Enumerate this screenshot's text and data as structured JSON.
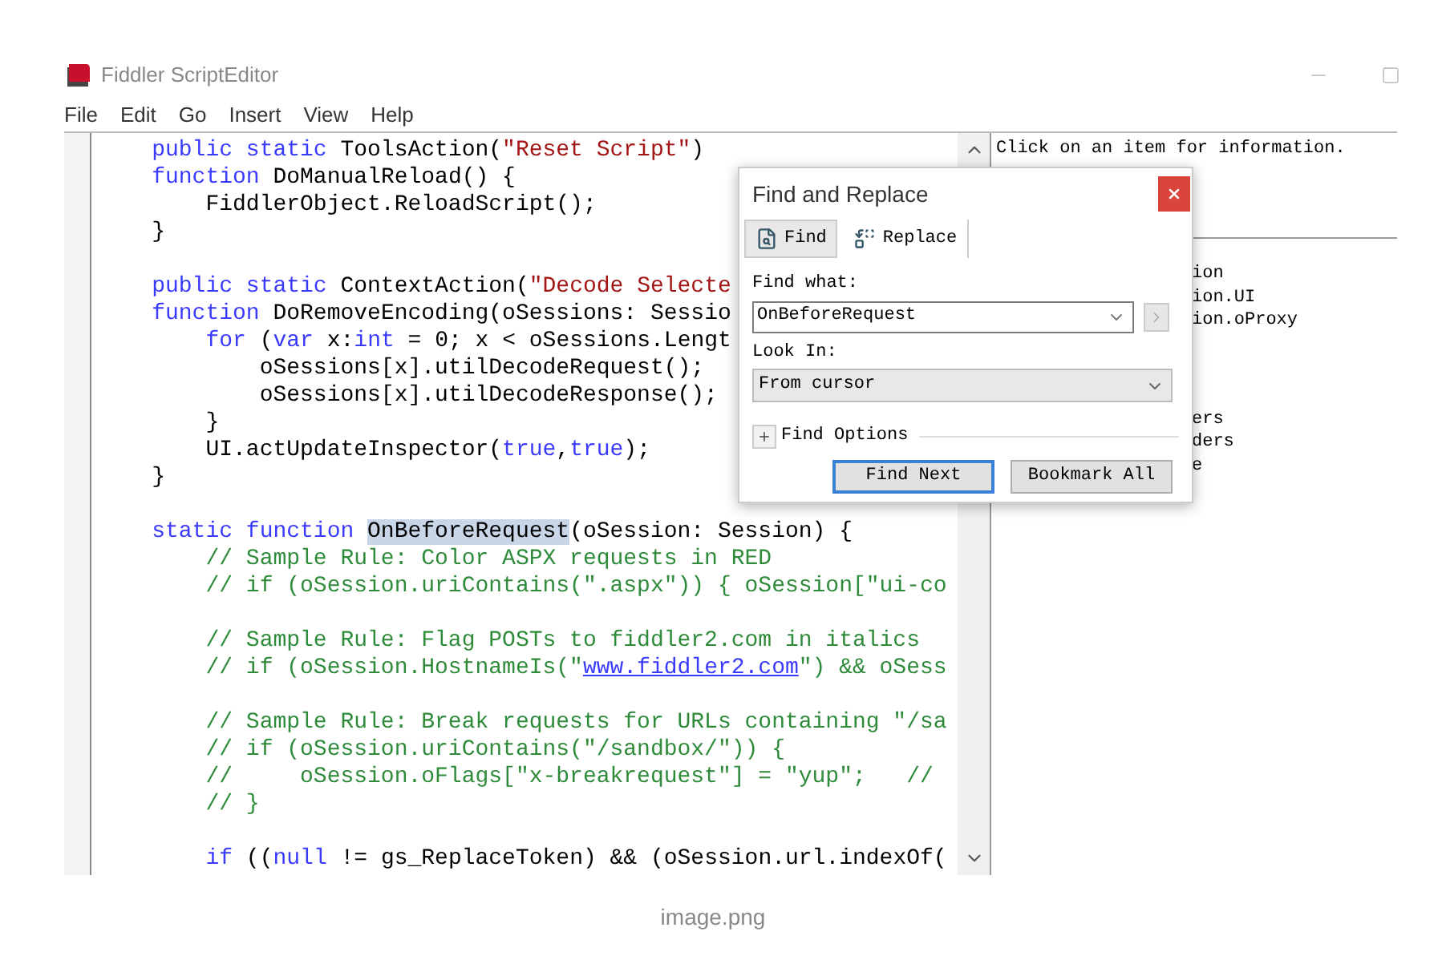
{
  "window": {
    "title": "Fiddler ScriptEditor"
  },
  "menu": [
    "File",
    "Edit",
    "Go",
    "Insert",
    "View",
    "Help"
  ],
  "code_lines": [
    {
      "kind": "code",
      "tokens": [
        {
          "kind": "keyword",
          "text": "    public static"
        },
        {
          "kind": "plain",
          "text": " ToolsAction("
        },
        {
          "kind": "string",
          "text": "\"Reset Script\""
        },
        {
          "kind": "plain",
          "text": ")"
        }
      ]
    },
    {
      "kind": "code",
      "tokens": [
        {
          "kind": "keyword",
          "text": "    function"
        },
        {
          "kind": "plain",
          "text": " DoManualReload() {"
        }
      ]
    },
    {
      "kind": "code",
      "tokens": [
        {
          "kind": "plain",
          "text": "        FiddlerObject.ReloadScript();"
        }
      ]
    },
    {
      "kind": "code",
      "tokens": [
        {
          "kind": "plain",
          "text": "    }"
        }
      ]
    },
    {
      "kind": "blank"
    },
    {
      "kind": "code",
      "tokens": [
        {
          "kind": "keyword",
          "text": "    public static"
        },
        {
          "kind": "plain",
          "text": " ContextAction("
        },
        {
          "kind": "string",
          "text": "\"Decode Selecte"
        }
      ]
    },
    {
      "kind": "code",
      "tokens": [
        {
          "kind": "keyword",
          "text": "    function"
        },
        {
          "kind": "plain",
          "text": " DoRemoveEncoding(oSessions: Sessio"
        }
      ]
    },
    {
      "kind": "code",
      "tokens": [
        {
          "kind": "keyword",
          "text": "        for"
        },
        {
          "kind": "plain",
          "text": " ("
        },
        {
          "kind": "keyword",
          "text": "var"
        },
        {
          "kind": "plain",
          "text": " x:"
        },
        {
          "kind": "keyword",
          "text": "int"
        },
        {
          "kind": "plain",
          "text": " = 0; x < oSessions.Lengt"
        }
      ]
    },
    {
      "kind": "code",
      "tokens": [
        {
          "kind": "plain",
          "text": "            oSessions[x].utilDecodeRequest();"
        }
      ]
    },
    {
      "kind": "code",
      "tokens": [
        {
          "kind": "plain",
          "text": "            oSessions[x].utilDecodeResponse();"
        }
      ]
    },
    {
      "kind": "code",
      "tokens": [
        {
          "kind": "plain",
          "text": "        }"
        }
      ]
    },
    {
      "kind": "code",
      "tokens": [
        {
          "kind": "plain",
          "text": "        UI.actUpdateInspector("
        },
        {
          "kind": "keyword",
          "text": "true"
        },
        {
          "kind": "plain",
          "text": ","
        },
        {
          "kind": "keyword",
          "text": "true"
        },
        {
          "kind": "plain",
          "text": ");"
        }
      ]
    },
    {
      "kind": "code",
      "tokens": [
        {
          "kind": "plain",
          "text": "    }"
        }
      ]
    },
    {
      "kind": "blank"
    },
    {
      "kind": "code",
      "tokens": [
        {
          "kind": "keyword",
          "text": "    static function "
        },
        {
          "kind": "highlight",
          "text": "OnBeforeRequest"
        },
        {
          "kind": "plain",
          "text": "(oSession: Session) {"
        }
      ]
    },
    {
      "kind": "code",
      "tokens": [
        {
          "kind": "comment",
          "text": "        // Sample Rule: Color ASPX requests in RED"
        }
      ]
    },
    {
      "kind": "code",
      "tokens": [
        {
          "kind": "comment",
          "text": "        // if (oSession.uriContains(\".aspx\")) { oSession[\"ui-co"
        }
      ]
    },
    {
      "kind": "blank"
    },
    {
      "kind": "code",
      "tokens": [
        {
          "kind": "comment",
          "text": "        // Sample Rule: Flag POSTs to fiddler2.com in italics"
        }
      ]
    },
    {
      "kind": "code",
      "tokens": [
        {
          "kind": "comment",
          "text": "        // if (oSession.HostnameIs(\""
        },
        {
          "kind": "link",
          "text": "www.fiddler2.com"
        },
        {
          "kind": "comment",
          "text": "\") && oSess"
        }
      ]
    },
    {
      "kind": "blank"
    },
    {
      "kind": "code",
      "tokens": [
        {
          "kind": "comment",
          "text": "        // Sample Rule: Break requests for URLs containing \"/sa"
        }
      ]
    },
    {
      "kind": "code",
      "tokens": [
        {
          "kind": "comment",
          "text": "        // if (oSession.uriContains(\"/sandbox/\")) {"
        }
      ]
    },
    {
      "kind": "code",
      "tokens": [
        {
          "kind": "comment",
          "text": "        //     oSession.oFlags[\"x-breakrequest\"] = \"yup\";   //"
        }
      ]
    },
    {
      "kind": "code",
      "tokens": [
        {
          "kind": "comment",
          "text": "        // }"
        }
      ]
    },
    {
      "kind": "blank"
    },
    {
      "kind": "code",
      "tokens": [
        {
          "kind": "keyword",
          "text": "        if"
        },
        {
          "kind": "plain",
          "text": " (("
        },
        {
          "kind": "keyword",
          "text": "null"
        },
        {
          "kind": "plain",
          "text": " != gs_ReplaceToken) && (oSession.url.indexOf("
        }
      ]
    }
  ],
  "info_panel": {
    "text": "Click on an item for information.",
    "item_groups": [
      [
        "ion",
        "ion.UI",
        "ion.oProxy"
      ],
      [
        "ers",
        "ders",
        "e"
      ]
    ]
  },
  "find_dialog": {
    "title": "Find and Replace",
    "tabs": [
      {
        "label": "Find",
        "selected": true
      },
      {
        "label": "Replace",
        "selected": false
      }
    ],
    "find_what": {
      "label": "Find what:",
      "value": "OnBeforeRequest"
    },
    "look_in": {
      "label": "Look In:",
      "value": "From cursor"
    },
    "find_options": {
      "label": "Find Options",
      "expanded": false
    },
    "buttons": [
      "Find Next",
      "Bookmark All"
    ]
  },
  "caption": "image.png"
}
